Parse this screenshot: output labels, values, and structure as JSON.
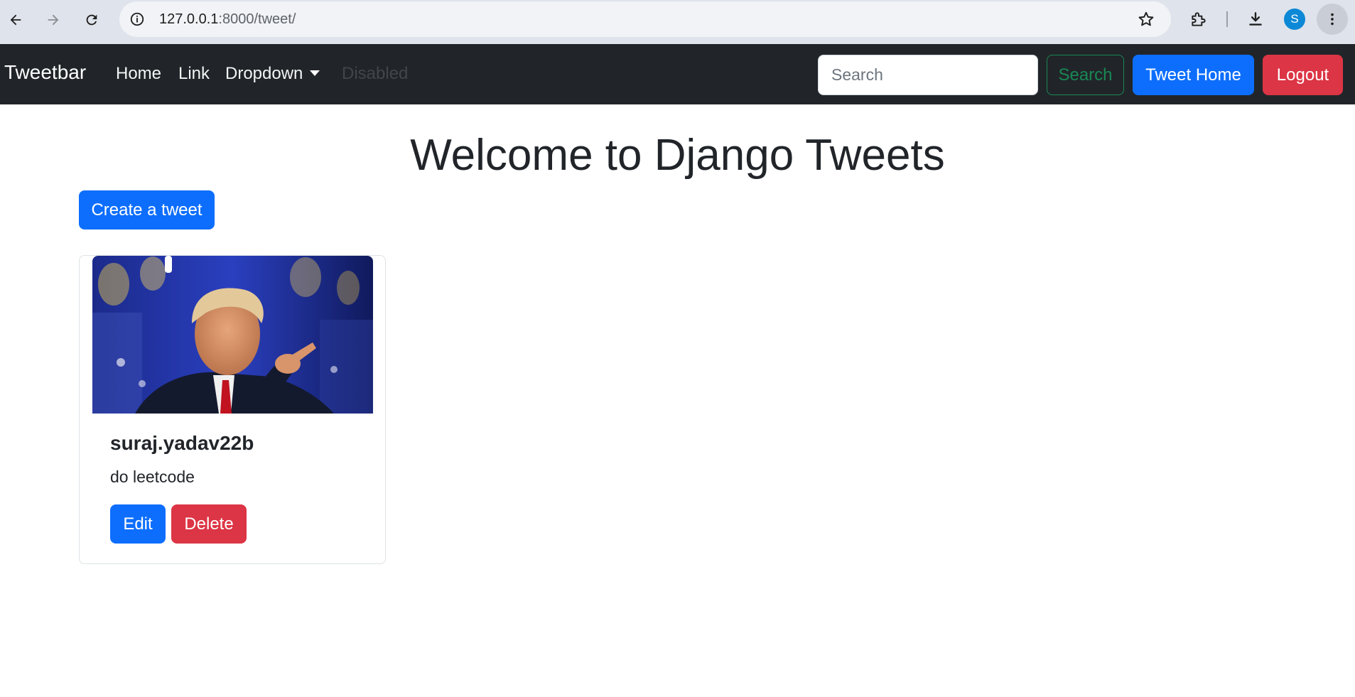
{
  "browser": {
    "url_host": "127.0.0.1",
    "url_rest": ":8000/tweet/",
    "avatar_letter": "S"
  },
  "navbar": {
    "brand": "Tweetbar",
    "links": {
      "home": "Home",
      "link": "Link",
      "dropdown": "Dropdown",
      "disabled": "Disabled"
    },
    "search_placeholder": "Search",
    "search_button": "Search",
    "tweet_home_button": "Tweet Home",
    "logout_button": "Logout"
  },
  "main": {
    "title": "Welcome to Django Tweets",
    "create_button": "Create a tweet"
  },
  "tweets": [
    {
      "username": "suraj.yadav22b",
      "text": "do leetcode",
      "edit_label": "Edit",
      "delete_label": "Delete"
    }
  ],
  "colors": {
    "navbar_bg": "#212529",
    "primary": "#0d6efd",
    "danger": "#dc3545",
    "success": "#198754"
  }
}
